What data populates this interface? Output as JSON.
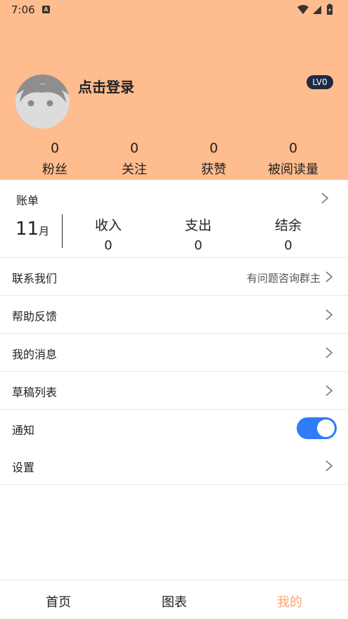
{
  "status_bar": {
    "time": "7:06",
    "notification_icon": "a-icon"
  },
  "profile": {
    "login_text": "点击登录",
    "level": "LV0",
    "stats": [
      {
        "value": "0",
        "label": "粉丝"
      },
      {
        "value": "0",
        "label": "关注"
      },
      {
        "value": "0",
        "label": "获赞"
      },
      {
        "value": "0",
        "label": "被阅读量"
      }
    ]
  },
  "bill": {
    "title": "账单",
    "month_number": "11",
    "month_unit": "月",
    "columns": [
      {
        "label": "收入",
        "value": "0"
      },
      {
        "label": "支出",
        "value": "0"
      },
      {
        "label": "结余",
        "value": "0"
      }
    ]
  },
  "menu": {
    "contact": {
      "label": "联系我们",
      "hint": "有问题咨询群主"
    },
    "help": {
      "label": "帮助反馈"
    },
    "messages": {
      "label": "我的消息"
    },
    "drafts": {
      "label": "草稿列表"
    },
    "notify": {
      "label": "通知",
      "enabled": true
    },
    "settings": {
      "label": "设置"
    }
  },
  "tabs": [
    {
      "label": "首页",
      "active": false
    },
    {
      "label": "图表",
      "active": false
    },
    {
      "label": "我的",
      "active": true
    }
  ],
  "colors": {
    "header_bg": "#FFBC8E",
    "active_tab": "#FFA46A",
    "toggle_on": "#2F7CF6",
    "badge_bg": "#1F2A44"
  }
}
